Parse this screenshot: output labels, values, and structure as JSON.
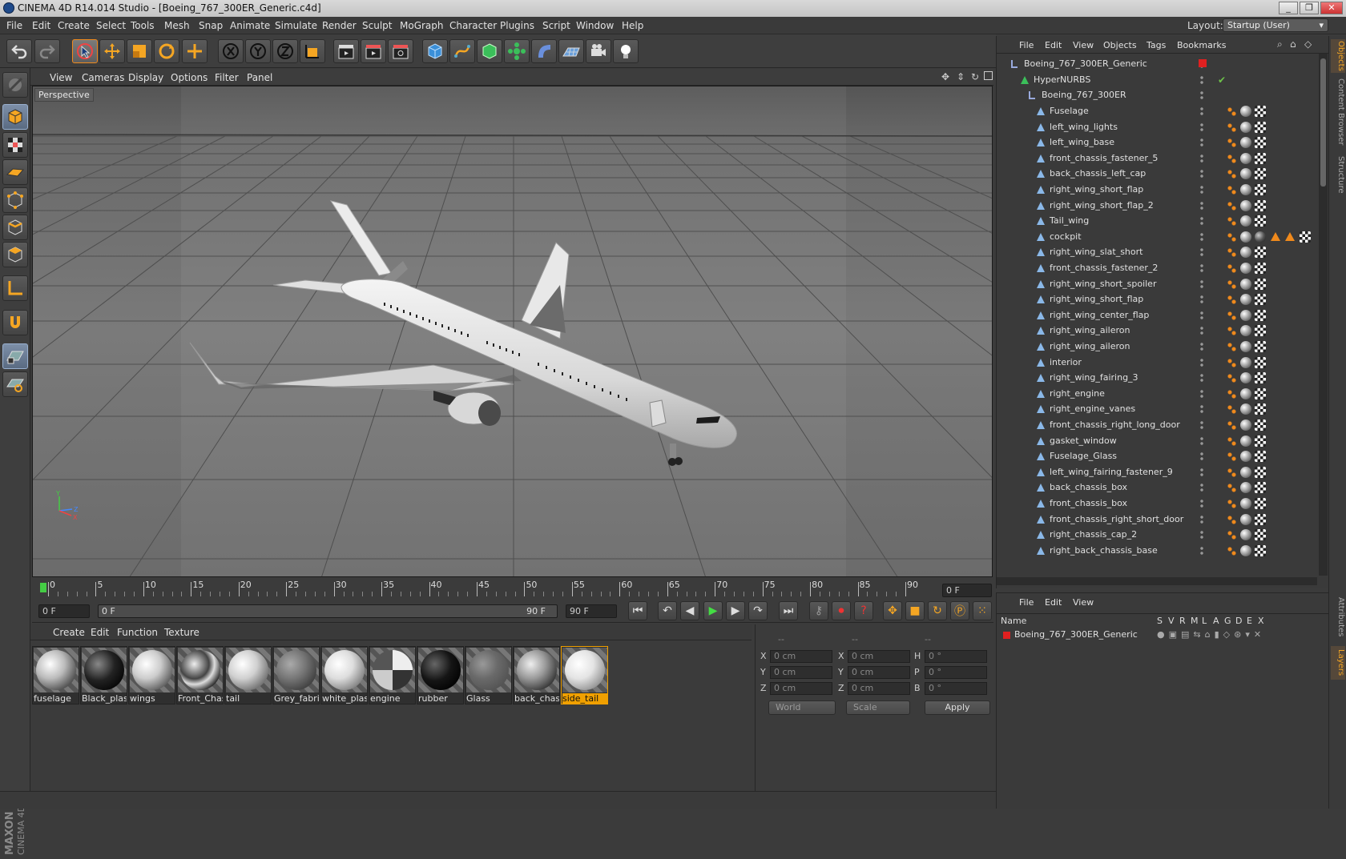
{
  "window": {
    "title": "CINEMA 4D R14.014 Studio - [Boeing_767_300ER_Generic.c4d]",
    "buttons": [
      "_",
      "❐",
      "✕"
    ]
  },
  "menubar": {
    "items": [
      "File",
      "Edit",
      "Create",
      "Select",
      "Tools",
      "Mesh",
      "Snap",
      "Animate",
      "Simulate",
      "Render",
      "Sculpt",
      "MoGraph",
      "Character",
      "Plugins",
      "Script",
      "Window",
      "Help"
    ],
    "layout_label": "Layout:",
    "layout_value": "Startup (User)"
  },
  "viewport": {
    "menu": [
      "View",
      "Cameras",
      "Display",
      "Options",
      "Filter",
      "Panel"
    ],
    "label": "Perspective",
    "axis": {
      "x": "X",
      "y": "Y",
      "z": "Z"
    }
  },
  "timeline": {
    "ticks": [
      "0",
      "5",
      "10",
      "15",
      "20",
      "25",
      "30",
      "35",
      "40",
      "45",
      "50",
      "55",
      "60",
      "65",
      "70",
      "75",
      "80",
      "85",
      "90"
    ],
    "frame_display": "0 F"
  },
  "transport": {
    "start": "0 F",
    "range_start": "0 F",
    "range_end": "90 F",
    "end": "90 F"
  },
  "materials": {
    "menu": [
      "Create",
      "Edit",
      "Function",
      "Texture"
    ],
    "items": [
      "fuselage",
      "Black_plast",
      "wings",
      "Front_Chas",
      "tail",
      "Grey_fabric",
      "white_plas",
      "engine",
      "rubber",
      "Glass",
      "back_chass",
      "side_tail"
    ],
    "selected": "side_tail"
  },
  "coords": {
    "headers": [
      "--",
      "--",
      "--"
    ],
    "rows": [
      {
        "a": "X",
        "av": "0 cm",
        "b": "X",
        "bv": "0 cm",
        "c": "H",
        "cv": "0 °"
      },
      {
        "a": "Y",
        "av": "0 cm",
        "b": "Y",
        "bv": "0 cm",
        "c": "P",
        "cv": "0 °"
      },
      {
        "a": "Z",
        "av": "0 cm",
        "b": "Z",
        "bv": "0 cm",
        "c": "B",
        "cv": "0 °"
      }
    ],
    "world": "World",
    "scale": "Scale",
    "apply": "Apply"
  },
  "objects": {
    "menu": [
      "File",
      "Edit",
      "View",
      "Objects",
      "Tags",
      "Bookmarks"
    ],
    "root": "Boeing_767_300ER_Generic",
    "hypernurbs": "HyperNURBS",
    "group": "Boeing_767_300ER",
    "items": [
      "Fuselage",
      "left_wing_lights",
      "left_wing_base",
      "front_chassis_fastener_5",
      "back_chassis_left_cap",
      "right_wing_short_flap",
      "right_wing_short_flap_2",
      "Tail_wing",
      "cockpit",
      "right_wing_slat_short",
      "front_chassis_fastener_2",
      "right_wing_short_spoiler",
      "right_wing_short_flap",
      "right_wing_center_flap",
      "right_wing_aileron",
      "right_wing_aileron",
      "interior",
      "right_wing_fairing_3",
      "right_engine",
      "right_engine_vanes",
      "front_chassis_right_long_door",
      "gasket_window",
      "Fuselage_Glass",
      "left_wing_fairing_fastener_9",
      "back_chassis_box",
      "front_chassis_box",
      "front_chassis_right_short_door",
      "right_chassis_cap_2",
      "right_back_chassis_base"
    ]
  },
  "right_tabs": [
    "Objects",
    "Content Browser",
    "Structure",
    "Attributes",
    "Layers"
  ],
  "layers": {
    "menu": [
      "File",
      "Edit",
      "View"
    ],
    "headers": [
      "Name",
      "S",
      "V",
      "R",
      "M",
      "L",
      "A",
      "G",
      "D",
      "E",
      "X"
    ],
    "row": "Boeing_767_300ER_Generic"
  },
  "colors": {
    "accent": "#f08a1c",
    "selection": "#f0a000",
    "layer_red": "#e02020",
    "check_green": "#6ec24a"
  }
}
